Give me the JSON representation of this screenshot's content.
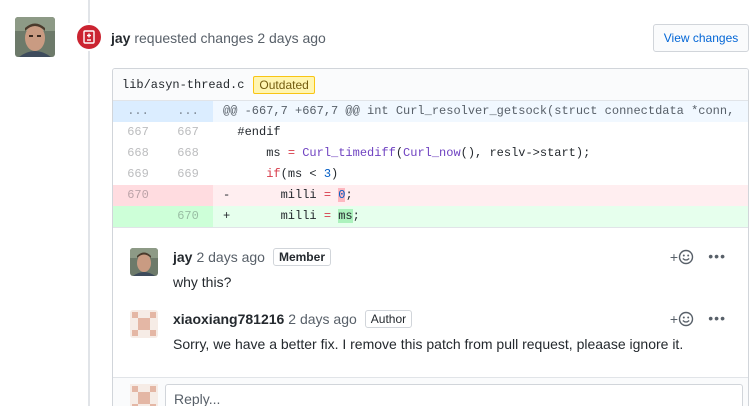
{
  "review": {
    "author": "jay",
    "action": "requested changes",
    "time": "2 days ago",
    "view_changes_label": "View changes"
  },
  "file": {
    "path": "lib/asyn-thread.c",
    "badge": "Outdated"
  },
  "diff": {
    "hunk": {
      "old": "...",
      "new": "...",
      "text": "@@ -667,7 +667,7 @@ int Curl_resolver_getsock(struct connectdata *conn,"
    },
    "lines": [
      {
        "old": "667",
        "new": "667",
        "marker": " ",
        "text": "#endif"
      },
      {
        "old": "668",
        "new": "668",
        "marker": " ",
        "text": "    ms = Curl_timediff(Curl_now(), reslv->start);"
      },
      {
        "old": "669",
        "new": "669",
        "marker": " ",
        "text": "    if(ms < 3)"
      },
      {
        "old": "670",
        "new": "",
        "marker": "-",
        "text": "      milli = 0;"
      },
      {
        "old": "",
        "new": "670",
        "marker": "+",
        "text": "      milli = ms;"
      }
    ]
  },
  "comments": [
    {
      "author": "jay",
      "time": "2 days ago",
      "role": "Member",
      "body": "why this?"
    },
    {
      "author": "xiaoxiang781216",
      "time": "2 days ago",
      "role": "Author",
      "body": "Sorry, we have a better fix. I remove this patch from pull request, pleaase ignore it."
    }
  ],
  "reply": {
    "placeholder": "Reply..."
  },
  "colors": {
    "review_badge": "#cb2431",
    "link": "#0366d6",
    "deletion": "#ffeef0",
    "addition": "#e6ffed"
  }
}
